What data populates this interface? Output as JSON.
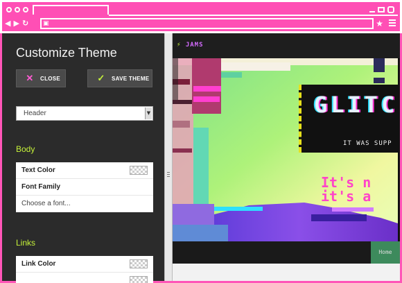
{
  "browser": {
    "icons": [
      "window-dots",
      "back-icon",
      "forward-icon",
      "reload-icon",
      "lock-icon",
      "star-icon",
      "menu-icon"
    ]
  },
  "panel": {
    "title": "Customize Theme",
    "close_label": "CLOSE",
    "save_label": "SAVE THEME",
    "section_select": "Header",
    "body": {
      "heading": "Body",
      "text_color": "Text Color",
      "font_family": "Font Family",
      "font_placeholder": "Choose a font..."
    },
    "links": {
      "heading": "Links",
      "link_color": "Link Color"
    }
  },
  "preview": {
    "logo": "JAMS",
    "hero_title": "GLITC",
    "hero_tagline": "IT WAS SUPP",
    "big_text_line1": "It's n",
    "big_text_line2": "it's a",
    "nav_home": "Home"
  },
  "colors": {
    "accent_pink": "#ff4fb5",
    "accent_lime": "#c6f23a",
    "panel_bg": "#2b2b2b",
    "nav_home_bg": "#3d8a5c"
  }
}
